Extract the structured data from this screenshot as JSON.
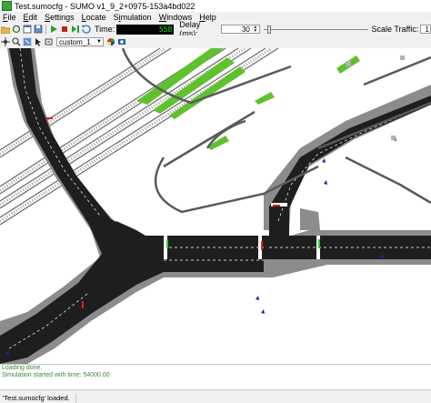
{
  "window": {
    "title": "Test.sumocfg - SUMO v1_9_2+0975-153a4bd022"
  },
  "menu": [
    {
      "label": "File",
      "underline": "F"
    },
    {
      "label": "Edit",
      "underline": "E"
    },
    {
      "label": "Settings",
      "underline": "S"
    },
    {
      "label": "Locate",
      "underline": "L"
    },
    {
      "label": "Simulation",
      "underline": "i"
    },
    {
      "label": "Windows",
      "underline": "W"
    },
    {
      "label": "Help",
      "underline": "H"
    }
  ],
  "toolbar": {
    "time_label": "Time:",
    "time_value": "558",
    "delay_label": "Delay (ms):",
    "delay_value": "30",
    "scale_label": "Scale Traffic:",
    "scale_value": "1"
  },
  "view": {
    "scheme": "custom_1"
  },
  "messages": [
    "Loading done.",
    "Simulation started with time: 54000.00"
  ],
  "status": {
    "text": "'Test.sumocfg' loaded."
  },
  "colors": {
    "road": "#1e1e1e",
    "sidewalk": "#8c8c8c",
    "rail": "#707070",
    "grass": "#5fc12e",
    "background": "#ffffff",
    "message_green": "#3a8a3a"
  }
}
